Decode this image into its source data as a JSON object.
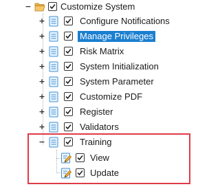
{
  "tree": {
    "root": {
      "label": "Customize System",
      "toggle": "−",
      "checked": true
    },
    "children": [
      {
        "label": "Configure Notifications",
        "toggle": "+",
        "checked": true,
        "selected": false
      },
      {
        "label": "Manage Privileges",
        "toggle": "+",
        "checked": true,
        "selected": true
      },
      {
        "label": "Risk Matrix",
        "toggle": "+",
        "checked": true,
        "selected": false
      },
      {
        "label": "System Initialization",
        "toggle": "+",
        "checked": true,
        "selected": false
      },
      {
        "label": "System Parameter",
        "toggle": "+",
        "checked": true,
        "selected": false
      },
      {
        "label": "Customize PDF",
        "toggle": "+",
        "checked": true,
        "selected": false
      },
      {
        "label": "Register",
        "toggle": "+",
        "checked": true,
        "selected": false
      },
      {
        "label": "Validators",
        "toggle": "+",
        "checked": true,
        "selected": false
      },
      {
        "label": "Training",
        "toggle": "−",
        "checked": true,
        "selected": false
      }
    ],
    "training_children": [
      {
        "label": "View",
        "checked": true
      },
      {
        "label": "Update",
        "checked": true
      }
    ]
  },
  "colors": {
    "selection": "#1b7fd0",
    "highlight_border": "#e03a46",
    "folder_fill": "#f5c66a",
    "doc_blue": "#3a8fd6"
  },
  "icons": {
    "root": "folder-open-icon",
    "child": "document-icon",
    "leaf": "document-edit-icon",
    "check": "check-icon"
  }
}
